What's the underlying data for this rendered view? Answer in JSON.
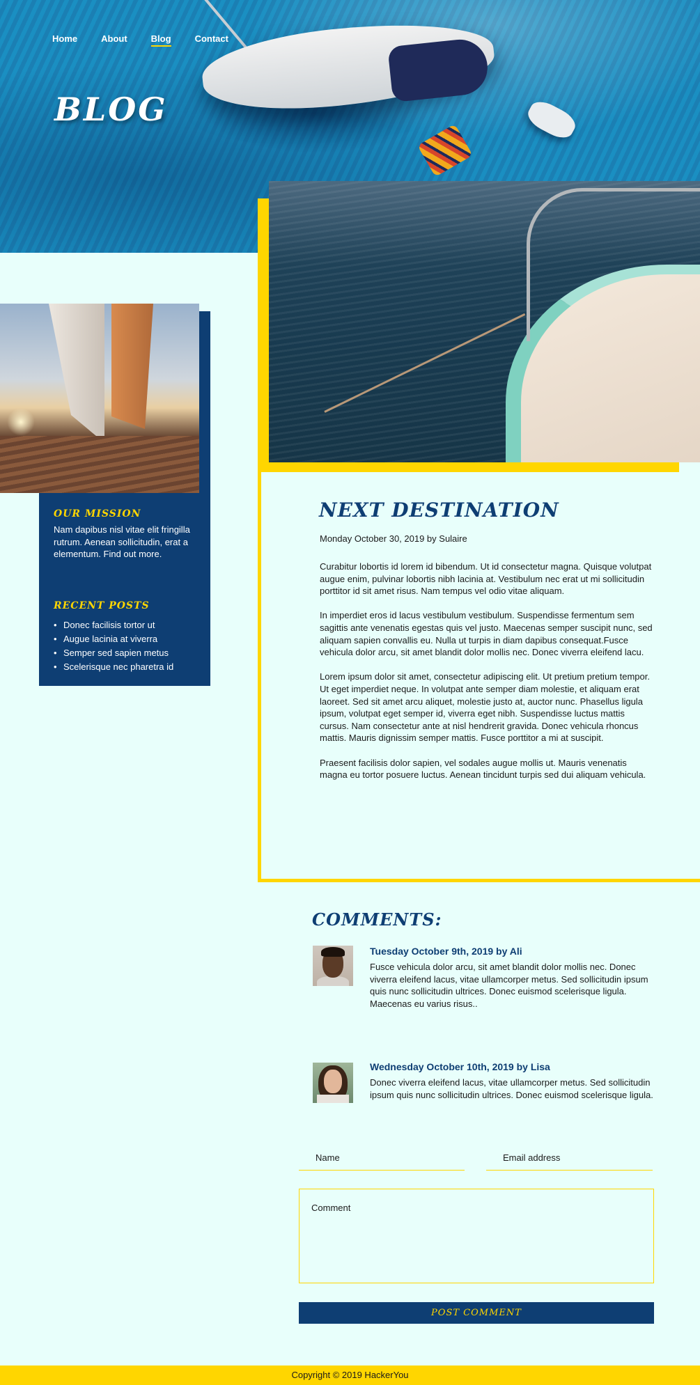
{
  "nav": {
    "items": [
      {
        "label": "Home"
      },
      {
        "label": "About"
      },
      {
        "label": "Blog"
      },
      {
        "label": "Contact"
      }
    ]
  },
  "hero": {
    "title": "BLOG"
  },
  "sidebar": {
    "mission_heading": "OUR MISSION",
    "mission_text": "Nam dapibus nisl vitae elit fringilla rutrum. Aenean sollicitudin, erat a elementum. Find out more.",
    "recent_heading": "RECENT POSTS",
    "recent_posts": [
      "Donec facilisis tortor ut",
      "Augue lacinia at viverra",
      "Semper sed sapien metus",
      "Scelerisque nec pharetra id"
    ]
  },
  "post": {
    "title": "NEXT DESTINATION",
    "meta": "Monday October 30, 2019 by Sulaire",
    "paragraphs": [
      "Curabitur lobortis id lorem id bibendum. Ut id consectetur magna. Quisque volutpat augue enim, pulvinar lobortis nibh lacinia at. Vestibulum nec erat ut mi sollicitudin porttitor id sit amet risus. Nam tempus vel odio vitae aliquam.",
      "In imperdiet eros id lacus vestibulum vestibulum. Suspendisse fermentum sem sagittis ante venenatis egestas quis vel justo. Maecenas semper suscipit nunc, sed aliquam sapien convallis eu. Nulla ut turpis in diam dapibus consequat.Fusce vehicula dolor arcu, sit amet blandit dolor mollis nec. Donec viverra eleifend lacu.",
      "Lorem ipsum dolor sit amet, consectetur adipiscing elit. Ut pretium pretium tempor. Ut eget imperdiet neque. In volutpat ante semper diam molestie, et aliquam erat laoreet. Sed sit amet arcu aliquet, molestie justo at, auctor nunc. Phasellus ligula ipsum, volutpat eget semper id, viverra eget nibh. Suspendisse luctus mattis cursus. Nam consectetur ante at nisl hendrerit gravida. Donec vehicula rhoncus mattis. Mauris dignissim semper mattis. Fusce porttitor a mi at suscipit.",
      "Praesent facilisis dolor sapien, vel sodales augue mollis ut. Mauris venenatis magna eu tortor posuere luctus. Aenean tincidunt turpis sed dui aliquam vehicula."
    ]
  },
  "comments": {
    "title": "COMMENTS:",
    "items": [
      {
        "header": "Tuesday October 9th, 2019 by Ali",
        "body": "Fusce vehicula dolor arcu, sit amet blandit dolor mollis nec. Donec viverra eleifend lacus, vitae ullamcorper metus. Sed sollicitudin ipsum quis nunc sollicitudin ultrices. Donec euismod scelerisque ligula. Maecenas eu varius risus.."
      },
      {
        "header": "Wednesday October 10th, 2019 by Lisa",
        "body": "Donec viverra eleifend lacus, vitae ullamcorper metus. Sed sollicitudin ipsum quis nunc sollicitudin ultrices. Donec euismod scelerisque ligula."
      }
    ]
  },
  "form": {
    "name_placeholder": "Name",
    "email_placeholder": "Email address",
    "comment_placeholder": "Comment",
    "submit_label": "POST COMMENT"
  },
  "footer": {
    "text": "Copyright © 2019 HackerYou"
  },
  "colors": {
    "navy": "#0e3e73",
    "yellow": "#ffd600",
    "background": "#e8fffb"
  }
}
